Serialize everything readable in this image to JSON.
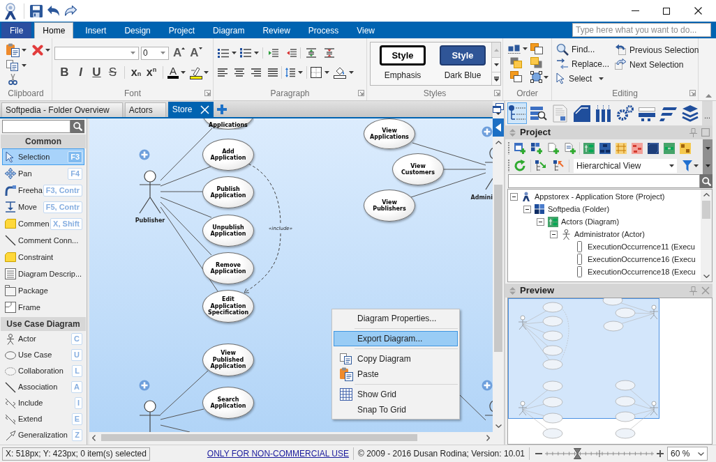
{
  "ribbon_tabs": [
    {
      "label": "File",
      "kind": "file",
      "selected": false
    },
    {
      "label": "Home",
      "kind": "tab",
      "selected": true
    },
    {
      "label": "Insert",
      "kind": "tab",
      "selected": false
    },
    {
      "label": "Design",
      "kind": "tab",
      "selected": false
    },
    {
      "label": "Project",
      "kind": "tab",
      "selected": false
    },
    {
      "label": "Diagram",
      "kind": "tab",
      "selected": false
    },
    {
      "label": "Review",
      "kind": "tab",
      "selected": false
    },
    {
      "label": "Process",
      "kind": "tab",
      "selected": false
    },
    {
      "label": "View",
      "kind": "tab",
      "selected": false
    }
  ],
  "search": {
    "placeholder": "Type here what you want to do..."
  },
  "ribbon": {
    "clipboard": {
      "label": "Clipboard"
    },
    "font": {
      "label": "Font",
      "size": "0",
      "size_buttons": [
        {
          "label": "A",
          "kind": "grow"
        },
        {
          "label": "A",
          "kind": "shrink"
        }
      ],
      "format_buttons": [
        {
          "label": "B",
          "kind": "bold"
        },
        {
          "label": "I",
          "kind": "italic"
        },
        {
          "label": "U",
          "kind": "underline"
        },
        {
          "label": "S",
          "kind": "strike"
        }
      ],
      "script_buttons": [
        {
          "label": "x$_{n}$"
        },
        {
          "label": "x$^{n}$"
        }
      ],
      "color_button": {
        "label": "A"
      }
    },
    "paragraph": {
      "label": "Paragraph"
    },
    "styles": {
      "label": "Styles",
      "items": [
        {
          "preview": "Style",
          "label": "Emphasis",
          "kind": "emphasis"
        },
        {
          "preview": "Style",
          "label": "Dark Blue",
          "kind": "dark"
        }
      ]
    },
    "order": {
      "label": "Order"
    },
    "editing": {
      "label": "Editing",
      "commands": [
        {
          "label": "Find...",
          "kind": "find"
        },
        {
          "label": "Replace...",
          "kind": "replace"
        },
        {
          "label": "Select",
          "kind": "select"
        },
        {
          "label": "Previous Selection",
          "kind": "previous"
        },
        {
          "label": "Next Selection",
          "kind": "next"
        }
      ]
    }
  },
  "document_tabs": [
    {
      "label": "Softpedia - Folder Overview",
      "selected": false
    },
    {
      "label": "Actors",
      "selected": false
    },
    {
      "label": "Store",
      "selected": true
    }
  ],
  "toolbox": {
    "sections": [
      {
        "title": "Common",
        "items": [
          {
            "label": "Selection",
            "shortcut": "F3",
            "selected": true
          },
          {
            "label": "Pan",
            "shortcut": "F4",
            "selected": false
          },
          {
            "label": "Freeha",
            "shortcut": "F3, Contr",
            "selected": false
          },
          {
            "label": "Move",
            "shortcut": "F5, Contr",
            "selected": false
          },
          {
            "label": "Commen",
            "shortcut": "X, Shift",
            "selected": false
          },
          {
            "label": "Comment Conn...",
            "selected": false
          },
          {
            "label": "Constraint",
            "selected": false
          },
          {
            "label": "Diagram Descrip...",
            "selected": false
          },
          {
            "label": "Package",
            "selected": false
          },
          {
            "label": "Frame",
            "selected": false
          }
        ]
      },
      {
        "title": "Use Case Diagram",
        "items": [
          {
            "label": "Actor",
            "shortcut": "C",
            "selected": false
          },
          {
            "label": "Use Case",
            "shortcut": "U",
            "selected": false
          },
          {
            "label": "Collaboration",
            "shortcut": "L",
            "selected": false
          },
          {
            "label": "Association",
            "shortcut": "A",
            "selected": false
          },
          {
            "label": "Include",
            "shortcut": "I",
            "selected": false
          },
          {
            "label": "Extend",
            "shortcut": "E",
            "selected": false
          },
          {
            "label": "Generalization",
            "shortcut": "Z",
            "selected": false
          }
        ]
      }
    ]
  },
  "diagram": {
    "actors": [
      {
        "label": "Publisher"
      },
      {
        "label": "Admini"
      }
    ],
    "use_cases": [
      {
        "label": "Applications"
      },
      {
        "label": "View Applications"
      },
      {
        "label": "Add Application"
      },
      {
        "label": "View Customers"
      },
      {
        "label": "Publish Application"
      },
      {
        "label": "View Publishers"
      },
      {
        "label": "Unpublish Application"
      },
      {
        "label": "Remove Application"
      },
      {
        "label": "Edit Application Specification"
      },
      {
        "label": "View Published Application"
      },
      {
        "label": "Search Application"
      }
    ],
    "include_label": "«include»"
  },
  "context_menu": {
    "groups": [
      [
        {
          "label": "Diagram Properties...",
          "selected": false
        }
      ],
      [
        {
          "label": "Export Diagram...",
          "selected": true
        }
      ],
      [
        {
          "label": "Copy Diagram",
          "selected": false
        },
        {
          "label": "Paste",
          "selected": false
        }
      ],
      [
        {
          "label": "Show Grid",
          "selected": false
        },
        {
          "label": "Snap To Grid",
          "selected": false
        }
      ]
    ]
  },
  "side_panel": {
    "tabs": [
      {
        "selected": true
      },
      {
        "selected": false
      },
      {
        "selected": false
      },
      {
        "selected": false
      },
      {
        "selected": false
      },
      {
        "selected": false
      },
      {
        "selected": false
      },
      {
        "selected": false
      },
      {
        "selected": false
      }
    ],
    "overflow": "...",
    "project": {
      "title": "Project",
      "view": "Hierarchical View",
      "tree": [
        {
          "label": "Appstorex - Application Store (Project)",
          "kind": "project",
          "expanded": true,
          "children": [
            {
              "label": "Softpedia (Folder)",
              "kind": "folder",
              "expanded": true,
              "children": [
                {
                  "label": "Actors (Diagram)",
                  "kind": "diagram",
                  "expanded": true,
                  "children": [
                    {
                      "label": "Administrator (Actor)",
                      "kind": "actor",
                      "expanded": true,
                      "children": [
                        {
                          "label": "ExecutionOccurrence11 (Execu",
                          "kind": "execution"
                        },
                        {
                          "label": "ExecutionOccurrence16 (Execu",
                          "kind": "execution"
                        },
                        {
                          "label": "ExecutionOccurrence18 (Execu",
                          "kind": "execution"
                        }
                      ]
                    }
                  ]
                }
              ]
            }
          ]
        }
      ]
    },
    "preview": {
      "title": "Preview"
    }
  },
  "status_bar": {
    "position": "X: 518px; Y: 423px; 0 item(s) selected",
    "notice": "ONLY FOR NON-COMMERCIAL USE",
    "copyright": "© 2009 - 2016 Dusan Rodina; Version: 10.01",
    "zoom": {
      "level": 0.3,
      "value": "60 %"
    }
  }
}
